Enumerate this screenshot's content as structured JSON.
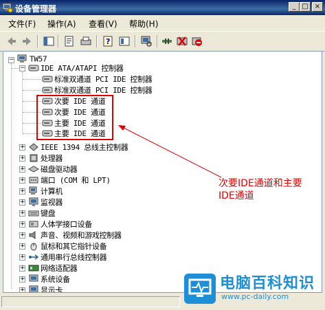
{
  "window": {
    "title": "设备管理器"
  },
  "menu": [
    {
      "label": "文件(F)"
    },
    {
      "label": "操作(A)"
    },
    {
      "label": "查看(V)"
    },
    {
      "label": "帮助(H)"
    }
  ],
  "tree": {
    "root": "TW57",
    "ide_category": "IDE ATA/ATAPI 控制器",
    "ide_children": [
      "标准双通道 PCI IDE 控制器",
      "标准双通道 PCI IDE 控制器",
      "次要 IDE 通道",
      "次要 IDE 通道",
      "主要 IDE 通道",
      "主要 IDE 通道"
    ],
    "categories": [
      "IEEE 1394 总线主控制器",
      "处理器",
      "磁盘驱动器",
      "端口 (COM 和 LPT)",
      "计算机",
      "监视器",
      "键盘",
      "人体学接口设备",
      "声音、视频和游戏控制器",
      "鼠标和其它指针设备",
      "通用串行总线控制器",
      "网络适配器",
      "系统设备",
      "显示卡"
    ]
  },
  "annotation": {
    "line1": "次要IDE通道和主要",
    "line2": "IDE通道"
  },
  "watermark": {
    "main": "电脑百科知识",
    "url": "www.pc-daily.com"
  },
  "colors": {
    "highlight": "#e00000",
    "titlebar": "#0a246a",
    "watermark": "#1d8fd6"
  }
}
